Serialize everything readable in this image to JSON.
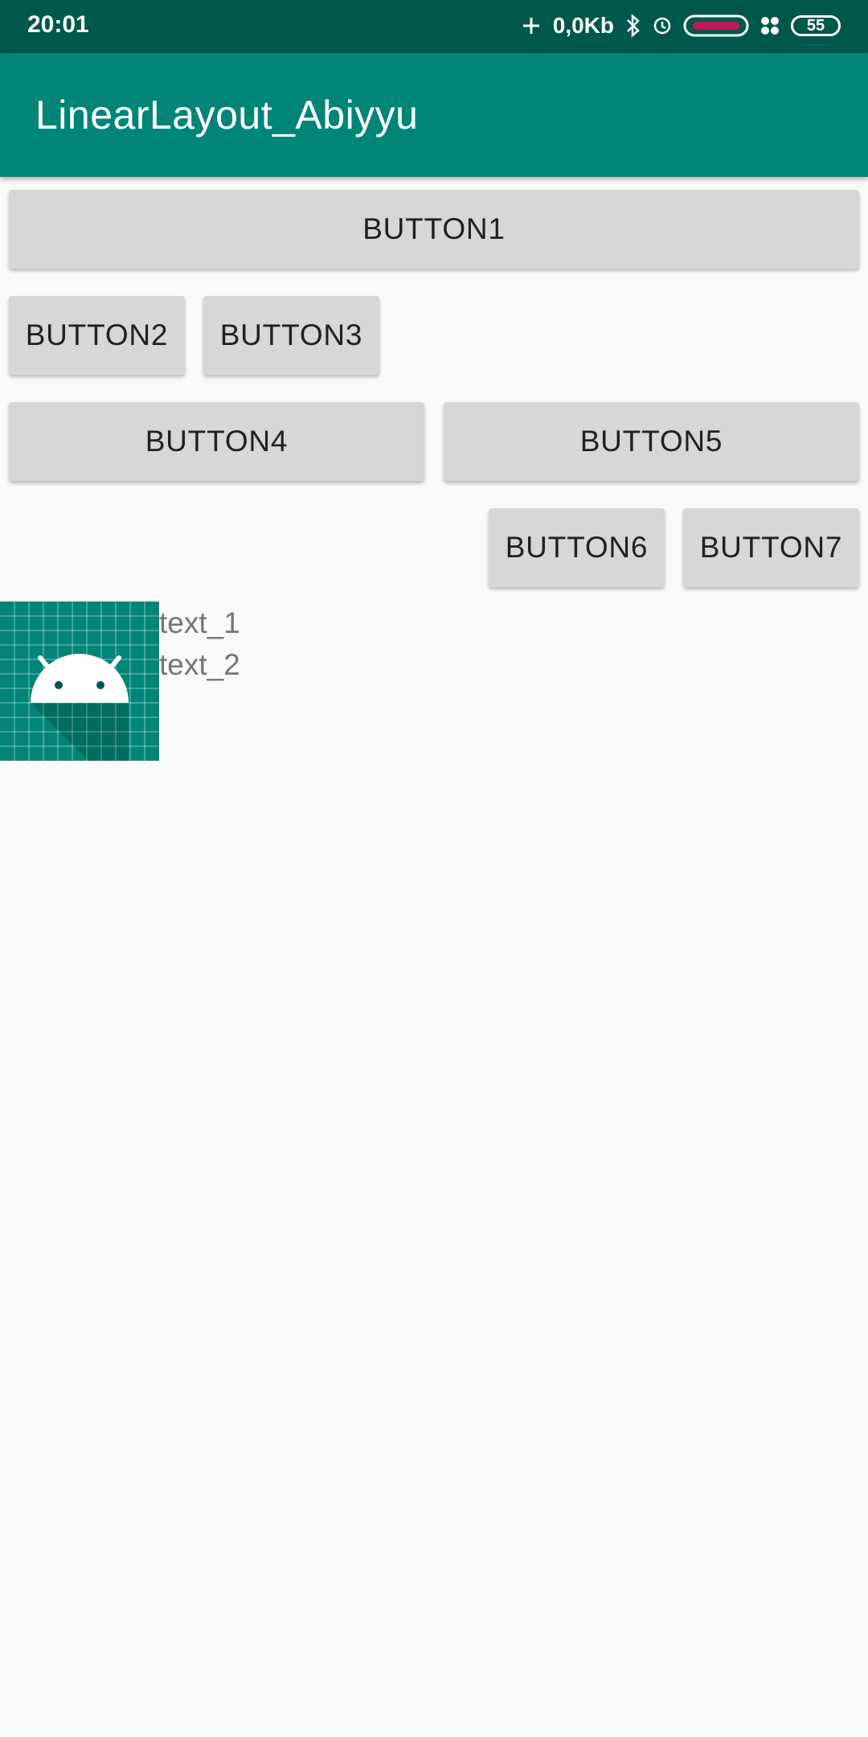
{
  "status_bar": {
    "time": "20:01",
    "net_speed": "0,0Kb",
    "battery": "55",
    "icons": [
      "plus-icon",
      "bluetooth-icon",
      "alarm-icon",
      "pill-icon",
      "dots-icon"
    ]
  },
  "app_bar": {
    "title": "LinearLayout_Abiyyu"
  },
  "buttons": {
    "b1": "BUTTON1",
    "b2": "BUTTON2",
    "b3": "BUTTON3",
    "b4": "BUTTON4",
    "b5": "BUTTON5",
    "b6": "BUTTON6",
    "b7": "BUTTON7"
  },
  "content": {
    "image_icon": "android-launcher-icon",
    "text_1": "text_1",
    "text_2": "text_2"
  },
  "colors": {
    "status_bar": "#00574b",
    "app_bar": "#008577",
    "button_bg": "#d6d7d7",
    "background": "#fafafa"
  }
}
